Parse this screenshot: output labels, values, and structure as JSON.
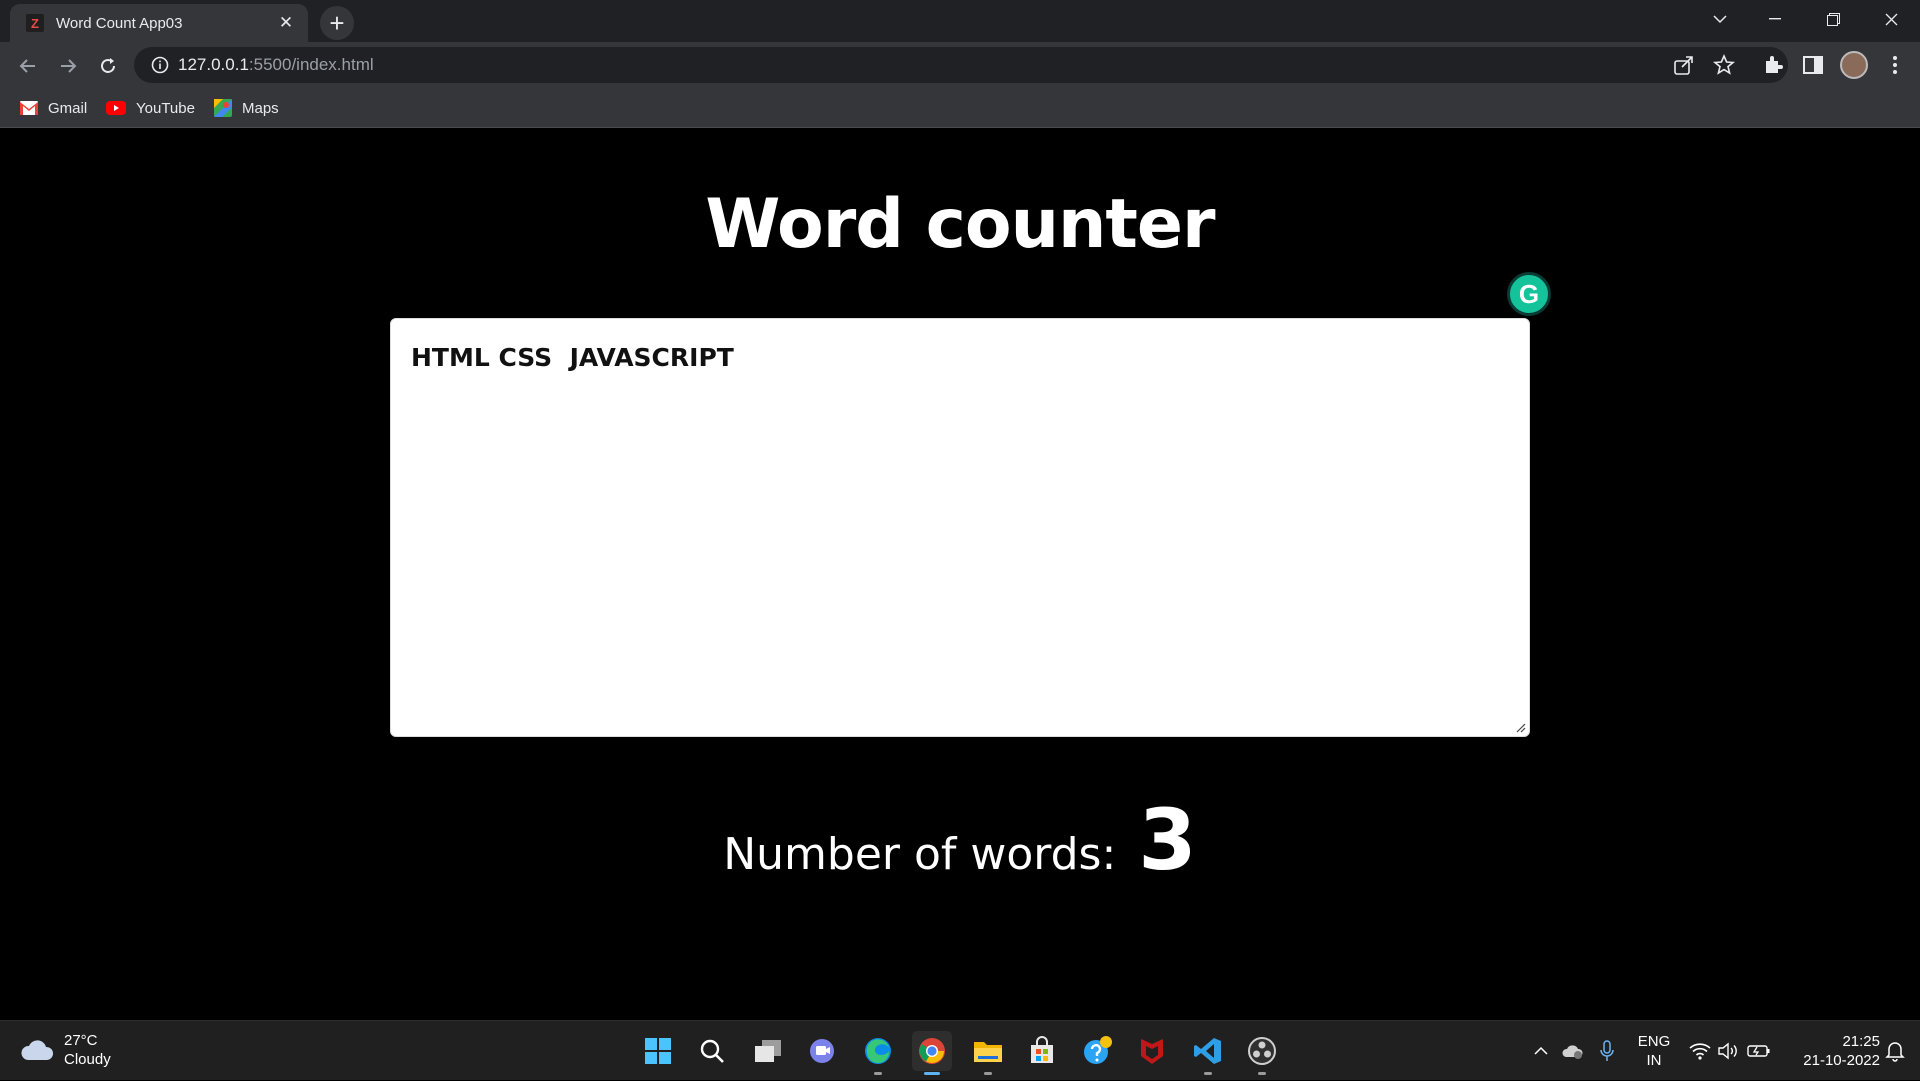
{
  "browser": {
    "tab": {
      "favicon_letter": "Z",
      "title": "Word Count App03"
    },
    "url_host": "127.0.0.1",
    "url_rest": ":5500/index.html",
    "bookmarks": [
      {
        "label": "Gmail",
        "icon": "gmail-icon"
      },
      {
        "label": "YouTube",
        "icon": "youtube-icon"
      },
      {
        "label": "Maps",
        "icon": "maps-icon"
      }
    ]
  },
  "page": {
    "title": "Word counter",
    "textarea_value": "HTML CSS  JAVASCRIPT",
    "count_label": "Number of words:",
    "count_value": "3",
    "grammarly_letter": "G"
  },
  "taskbar": {
    "weather": {
      "temp": "27°C",
      "condition": "Cloudy"
    },
    "apps": [
      "start-icon",
      "search-icon",
      "task-view-icon",
      "teams-chat-icon",
      "edge-icon",
      "chrome-icon",
      "file-explorer-icon",
      "store-icon",
      "get-help-icon",
      "mcafee-icon",
      "vscode-icon",
      "obs-icon"
    ],
    "language": {
      "lang": "ENG",
      "region": "IN"
    },
    "clock": {
      "time": "21:25",
      "date": "21-10-2022"
    }
  },
  "colors": {
    "page_bg": "#000000",
    "accent_grammarly": "#15c39a",
    "chrome_toolbar": "#35363a"
  }
}
